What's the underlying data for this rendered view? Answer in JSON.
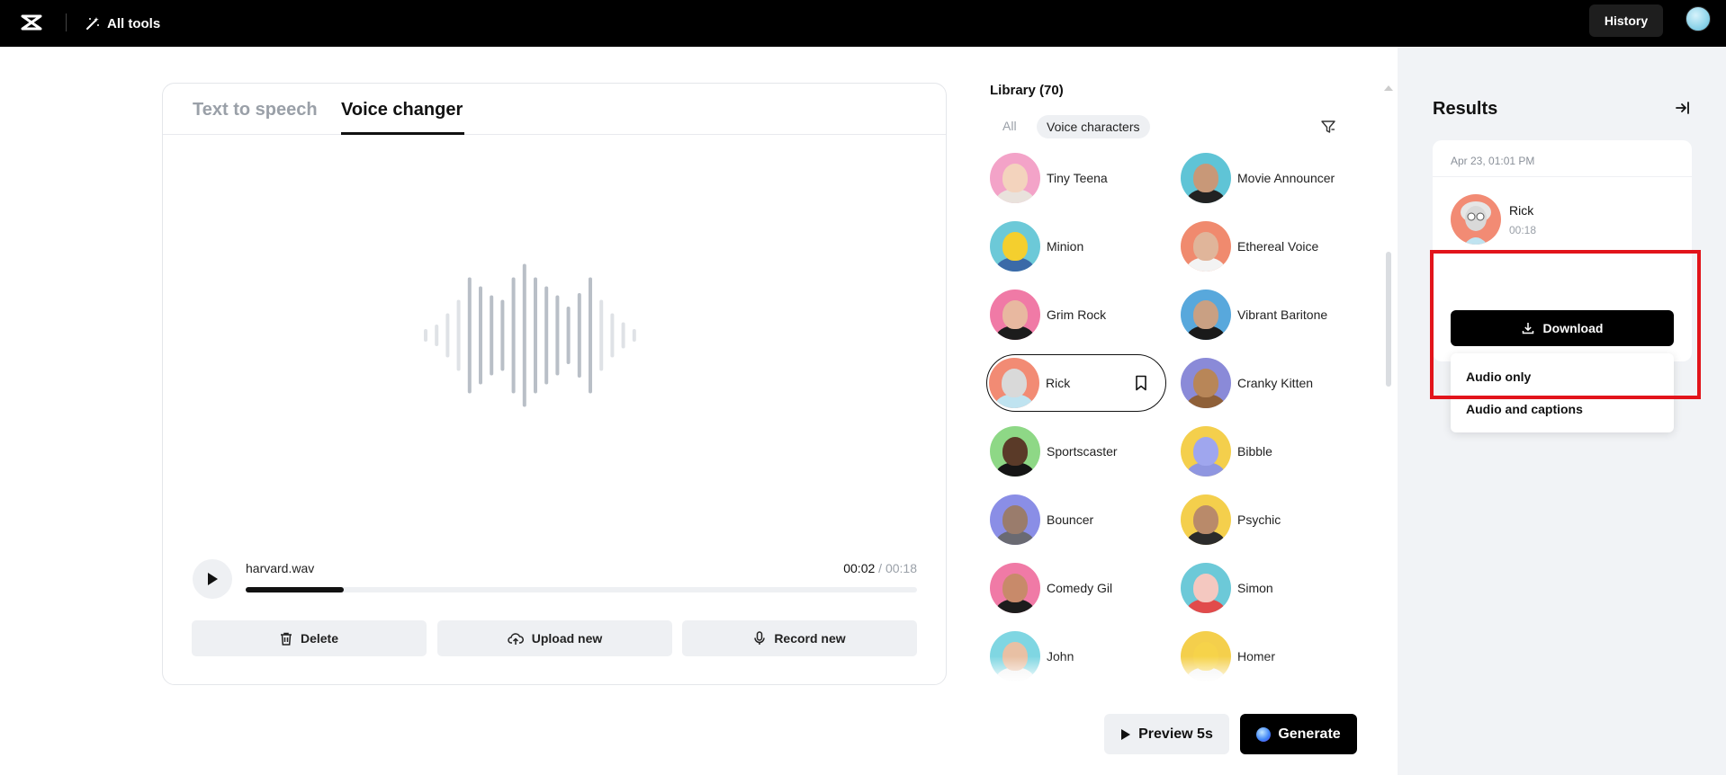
{
  "topbar": {
    "all_tools_label": "All tools",
    "history_label": "History"
  },
  "editor": {
    "tabs": [
      {
        "label": "Text to speech",
        "active": false
      },
      {
        "label": "Voice changer",
        "active": true
      }
    ],
    "player": {
      "filename": "harvard.wav",
      "current_time": "00:02",
      "separator": " / ",
      "total_time": "00:18",
      "progress": 0.146
    },
    "actions": {
      "delete_label": "Delete",
      "upload_label": "Upload new",
      "record_label": "Record new"
    }
  },
  "library": {
    "title": "Library (70)",
    "filters": {
      "all": "All",
      "voice_characters": "Voice characters"
    },
    "voices": [
      {
        "name": "Tiny Teena",
        "bg": "#f3a3c8",
        "skin": "#f3d3bd",
        "shirt": "#e9e2dc"
      },
      {
        "name": "Movie Announcer",
        "bg": "#5fc4d6",
        "skin": "#c89878",
        "shirt": "#222222"
      },
      {
        "name": "Minion",
        "bg": "#6cc9d8",
        "skin": "#f4cf2e",
        "shirt": "#3b6aa8"
      },
      {
        "name": "Ethereal Voice",
        "bg": "#f08a6e",
        "skin": "#e0b59a",
        "shirt": "#f3f3f3"
      },
      {
        "name": "Grim Rock",
        "bg": "#f07aa6",
        "skin": "#e8b8a0",
        "shirt": "#1c1c1c"
      },
      {
        "name": "Vibrant Baritone",
        "bg": "#58a8dc",
        "skin": "#c9a083",
        "shirt": "#1a1a1a"
      },
      {
        "name": "Rick",
        "bg": "#f28b74",
        "skin": "#d9d9d9",
        "shirt": "#bfe3f0",
        "selected": true
      },
      {
        "name": "Cranky Kitten",
        "bg": "#8a8ad8",
        "skin": "#b88658",
        "shirt": "#8f6038"
      },
      {
        "name": "Sportscaster",
        "bg": "#8ed886",
        "skin": "#5a3a28",
        "shirt": "#151515"
      },
      {
        "name": "Bibble",
        "bg": "#f4cf4c",
        "skin": "#9fa6ee",
        "shirt": "#8f96e0"
      },
      {
        "name": "Bouncer",
        "bg": "#8a8ee6",
        "skin": "#9a7c6c",
        "shirt": "#6a6a72"
      },
      {
        "name": "Psychic",
        "bg": "#f4cf4c",
        "skin": "#b98a6a",
        "shirt": "#2b2b2b"
      },
      {
        "name": "Comedy Gil",
        "bg": "#f07aa6",
        "skin": "#c88a6a",
        "shirt": "#1c1c1c"
      },
      {
        "name": "Simon",
        "bg": "#6cc9d8",
        "skin": "#f4c8c0",
        "shirt": "#e14b4b"
      },
      {
        "name": "John",
        "bg": "#7fd6e2",
        "skin": "#e8c0a4",
        "shirt": "#f2f2f2"
      },
      {
        "name": "Homer",
        "bg": "#f4cf4c",
        "skin": "#f6d34a",
        "shirt": "#f2f2f2"
      }
    ],
    "preview_label": "Preview 5s",
    "generate_label": "Generate"
  },
  "results": {
    "title": "Results",
    "item": {
      "date": "Apr 23, 01:01 PM",
      "name": "Rick",
      "duration": "00:18"
    },
    "download_label": "Download",
    "menu": [
      "Audio only",
      "Audio and captions"
    ]
  },
  "colors": {
    "accent_dark": "#000000",
    "highlight": "#e2141b",
    "panel_bg": "#f1f3f6"
  }
}
